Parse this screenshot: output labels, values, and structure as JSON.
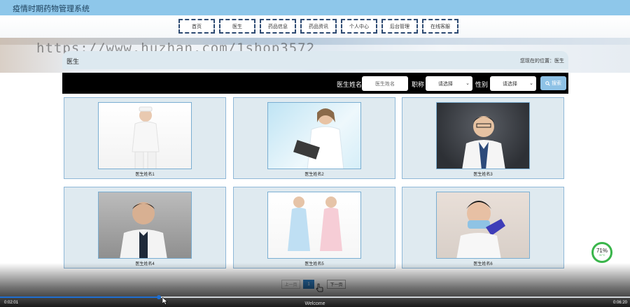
{
  "app": {
    "title": "疫情时期药物管理系统"
  },
  "nav": [
    "首页",
    "医生",
    "药品信息",
    "药品资讯",
    "个人中心",
    "后台管理",
    "在线客服"
  ],
  "watermark": "https://www.huzhan.com/1shop3572",
  "breadcrumb": {
    "section": "医生",
    "location": "您现在的位置：医生"
  },
  "search": {
    "name_label": "医生姓名",
    "name_placeholder": "医生姓名",
    "title_label": "职称",
    "title_value": "请选择",
    "gender_label": "性别",
    "gender_value": "请选择",
    "button_label": "搜索"
  },
  "doctors": [
    {
      "name": "医生姓名1"
    },
    {
      "name": "医生姓名2"
    },
    {
      "name": "医生姓名3"
    },
    {
      "name": "医生姓名4"
    },
    {
      "name": "医生姓名5"
    },
    {
      "name": "医生姓名6"
    }
  ],
  "pagination": {
    "prev": "上一页",
    "current": "1",
    "next": "下一页"
  },
  "widget": {
    "percent": "71%",
    "temp": "31°C"
  },
  "video": {
    "elapsed": "0:02:01",
    "duration": "0:06:20",
    "caption": "Welcome",
    "progress": 0.318
  },
  "colors": {
    "header": "#8ec7ea",
    "search_bg": "#000000",
    "card_bg": "#dfeaf0",
    "accent": "#2f7ec4"
  }
}
